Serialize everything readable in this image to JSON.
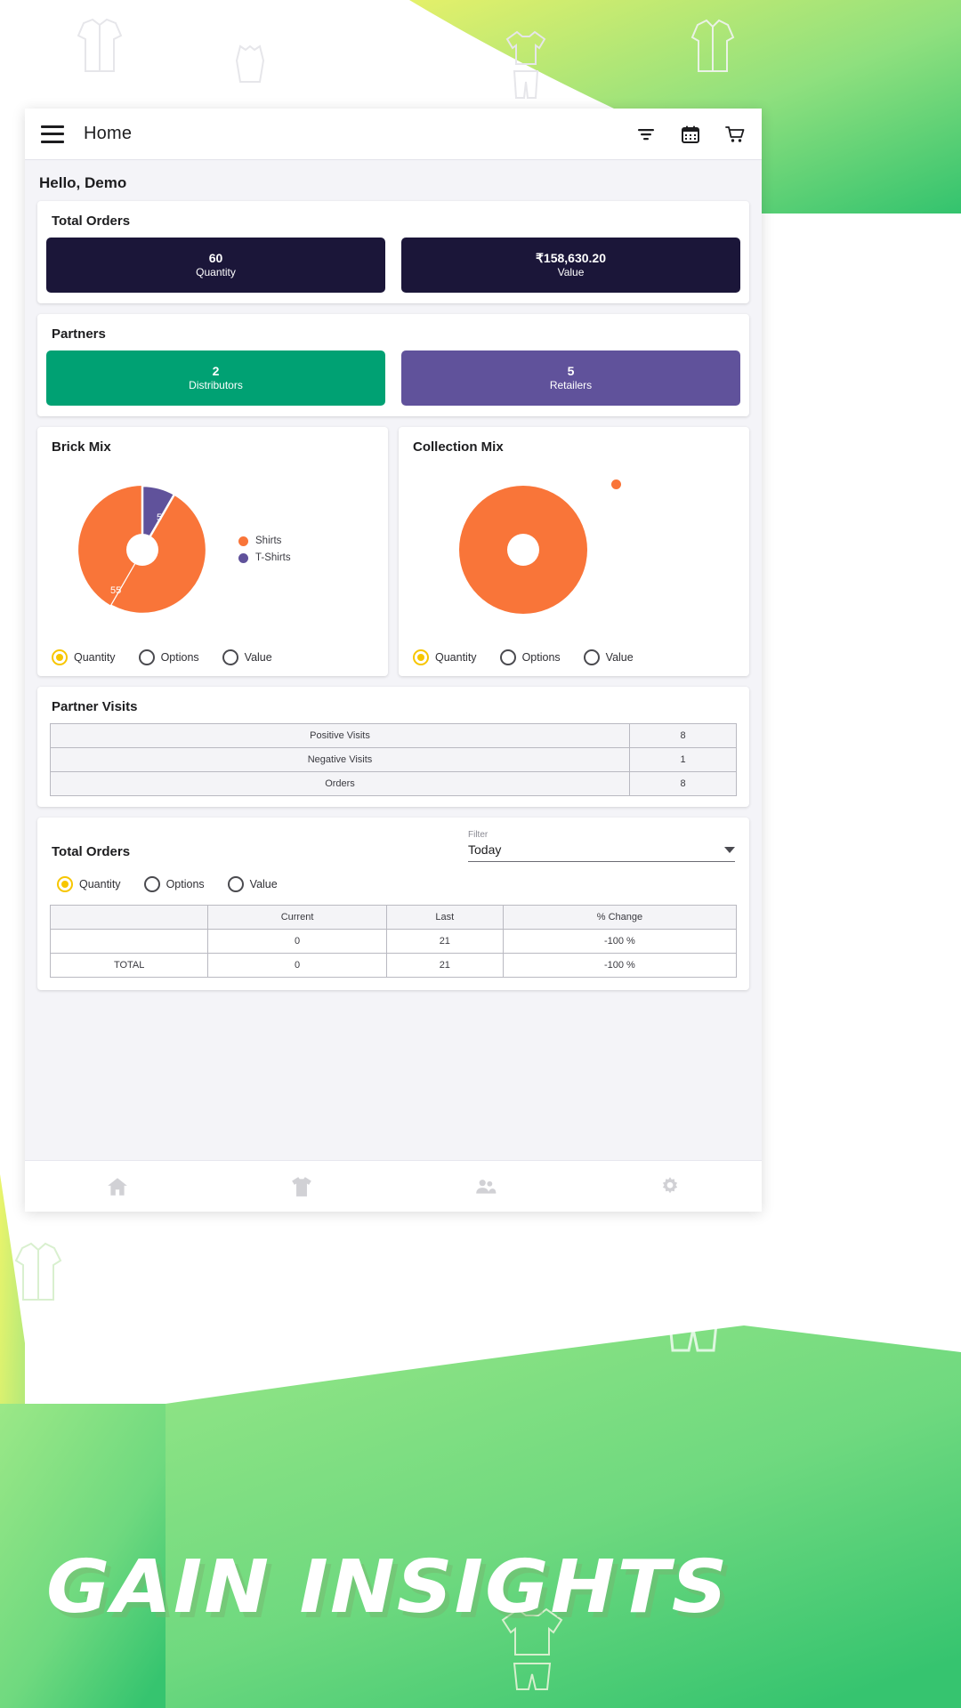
{
  "appbar": {
    "title": "Home",
    "menu_icon": "hamburger-menu-icon",
    "actions": [
      {
        "name": "filter-icon",
        "label": "Filter"
      },
      {
        "name": "calendar-icon",
        "label": "Calendar"
      },
      {
        "name": "cart-icon",
        "label": "Cart"
      }
    ]
  },
  "greeting": "Hello, Demo",
  "total_orders_top": {
    "title": "Total Orders",
    "tiles": [
      {
        "value": "60",
        "label": "Quantity",
        "color": "#1b1639"
      },
      {
        "value": "₹158,630.20",
        "label": "Value",
        "color": "#1b1639"
      }
    ]
  },
  "partners": {
    "title": "Partners",
    "tiles": [
      {
        "value": "2",
        "label": "Distributors",
        "color": "#00a173"
      },
      {
        "value": "5",
        "label": "Retailers",
        "color": "#60529b"
      }
    ]
  },
  "brick_mix": {
    "title": "Brick Mix",
    "legend": [
      {
        "label": "Shirts",
        "color": "#f97539"
      },
      {
        "label": "T-Shirts",
        "color": "#60529b"
      }
    ],
    "radios": [
      {
        "label": "Quantity",
        "selected": true
      },
      {
        "label": "Options",
        "selected": false
      },
      {
        "label": "Value",
        "selected": false
      }
    ]
  },
  "collection_mix": {
    "title": "Collection Mix",
    "legend": [
      {
        "label": "",
        "color": "#f97539"
      }
    ],
    "radios": [
      {
        "label": "Quantity",
        "selected": true
      },
      {
        "label": "Options",
        "selected": false
      },
      {
        "label": "Value",
        "selected": false
      }
    ]
  },
  "partner_visits": {
    "title": "Partner Visits",
    "rows": [
      {
        "name": "Positive Visits",
        "value": "8"
      },
      {
        "name": "Negative Visits",
        "value": "1"
      },
      {
        "name": "Orders",
        "value": "8"
      }
    ]
  },
  "total_orders_bottom": {
    "title": "Total Orders",
    "filter_label": "Filter",
    "filter_value": "Today",
    "radios": [
      {
        "label": "Quantity",
        "selected": true
      },
      {
        "label": "Options",
        "selected": false
      },
      {
        "label": "Value",
        "selected": false
      }
    ],
    "columns": [
      "",
      "Current",
      "Last",
      "% Change"
    ],
    "rows": [
      [
        "",
        "0",
        "21",
        "-100 %"
      ],
      [
        "TOTAL",
        "0",
        "21",
        "-100 %"
      ]
    ]
  },
  "bottom_nav": [
    {
      "name": "home-icon",
      "label": "Home"
    },
    {
      "name": "tshirt-icon",
      "label": "Products"
    },
    {
      "name": "people-icon",
      "label": "Partners"
    },
    {
      "name": "gear-icon",
      "label": "Settings"
    }
  ],
  "promo": {
    "headline": "GAIN INSIGHTS"
  },
  "chart_data": [
    {
      "type": "pie",
      "title": "Brick Mix",
      "categories": [
        "Shirts",
        "T-Shirts"
      ],
      "values": [
        55,
        5
      ],
      "colors": [
        "#f97539",
        "#60529b"
      ],
      "labels": [
        "55",
        "5"
      ],
      "legend_position": "right",
      "donut": true,
      "metric": "Quantity"
    },
    {
      "type": "pie",
      "title": "Collection Mix",
      "categories": [
        ""
      ],
      "values": [
        60
      ],
      "colors": [
        "#f97539"
      ],
      "labels": [
        ""
      ],
      "legend_position": "right",
      "donut": true,
      "metric": "Quantity"
    }
  ]
}
